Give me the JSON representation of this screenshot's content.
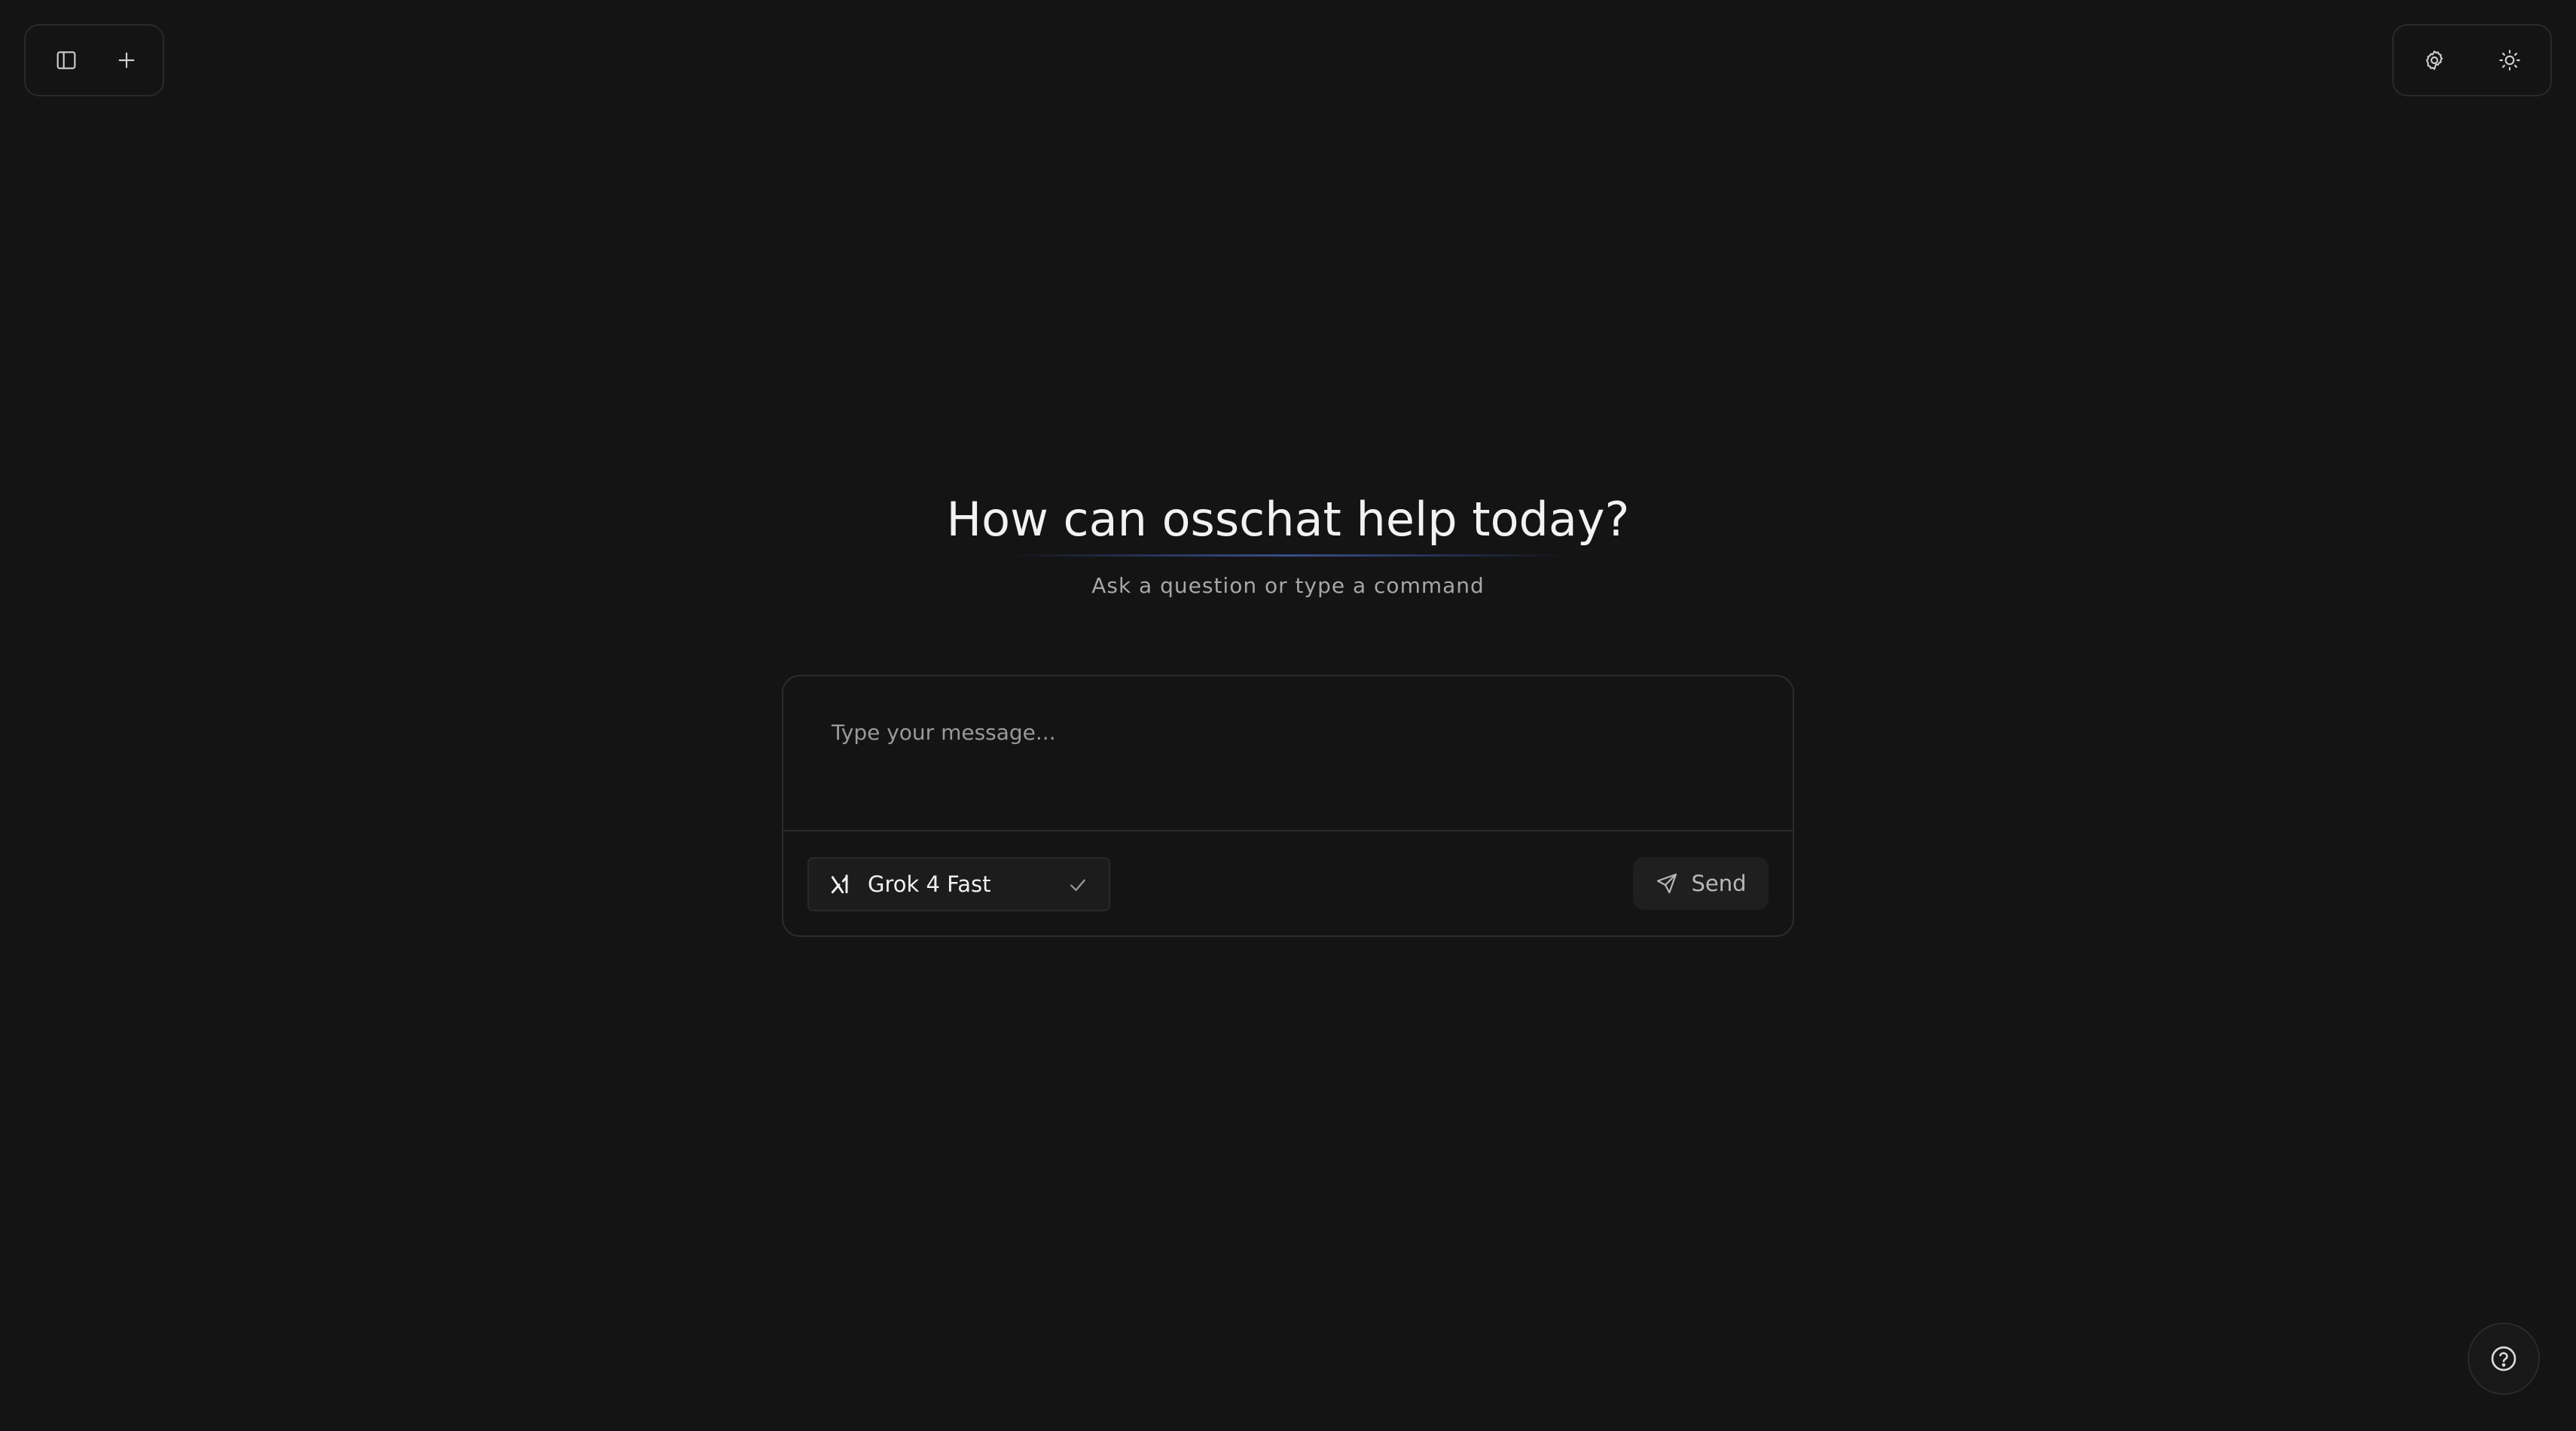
{
  "toolbar_left": {
    "sidebar_toggle_icon": "sidebar-panel-icon",
    "new_chat_icon": "plus-icon"
  },
  "toolbar_right": {
    "settings_icon": "gear-icon",
    "theme_icon": "sun-icon"
  },
  "hero": {
    "title": "How can osschat help today?",
    "subtitle": "Ask a question or type a command"
  },
  "composer": {
    "placeholder": "Type your message...",
    "value": "",
    "model": {
      "label": "Grok 4 Fast",
      "icon": "xai-logo-icon",
      "selected_icon": "check-icon"
    },
    "send": {
      "label": "Send",
      "icon": "send-icon"
    }
  },
  "help": {
    "icon": "question-circle-icon"
  },
  "colors": {
    "background": "#141414",
    "border": "#2a2a2a",
    "text_primary": "#f2f2f2",
    "text_muted": "#a7a7a7",
    "accent_underline": "#3a4f8a"
  }
}
